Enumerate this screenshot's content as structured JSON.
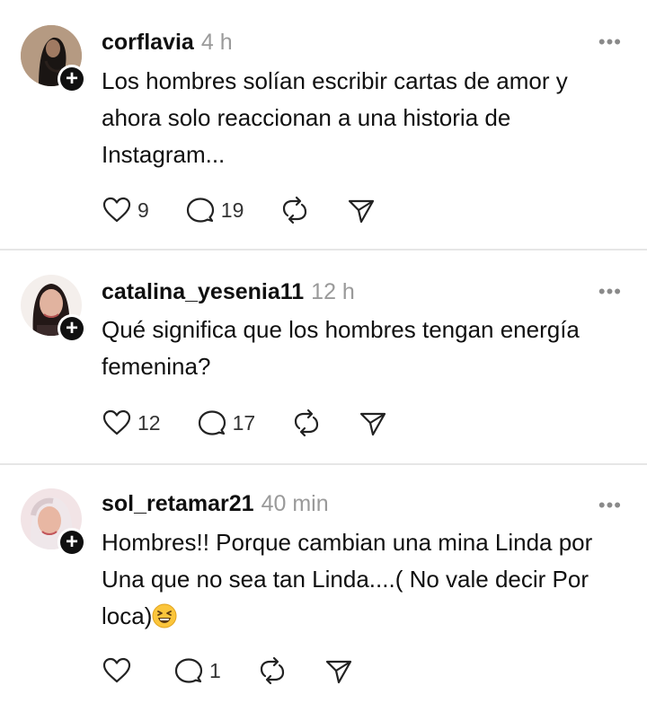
{
  "posts": [
    {
      "username": "corflavia",
      "time": "4 h",
      "text": "Los hombres solían escribir cartas de amor y ahora solo reaccionan a una historia de Instagram...",
      "likes": "9",
      "replies": "19"
    },
    {
      "username": "catalina_yesenia11",
      "time": "12 h",
      "text": "Qué significa que los hombres tengan energía femenina?",
      "likes": "12",
      "replies": "17"
    },
    {
      "username": "sol_retamar21",
      "time": "40 min",
      "text": "Hombres!! Porque cambian una mina Linda por Una que no sea tan Linda....( No vale decir Por loca)",
      "likes": "",
      "replies": "1"
    }
  ],
  "icons": {
    "like": "heart-icon",
    "reply": "comment-bubble-icon",
    "repost": "repost-icon",
    "share": "send-icon",
    "more": "more-options-icon",
    "follow": "plus-icon",
    "emoji": "grinning-squinting-face-emoji"
  },
  "colors": {
    "text": "#101010",
    "muted": "#9a9a9a",
    "divider": "#e6e6e6"
  }
}
